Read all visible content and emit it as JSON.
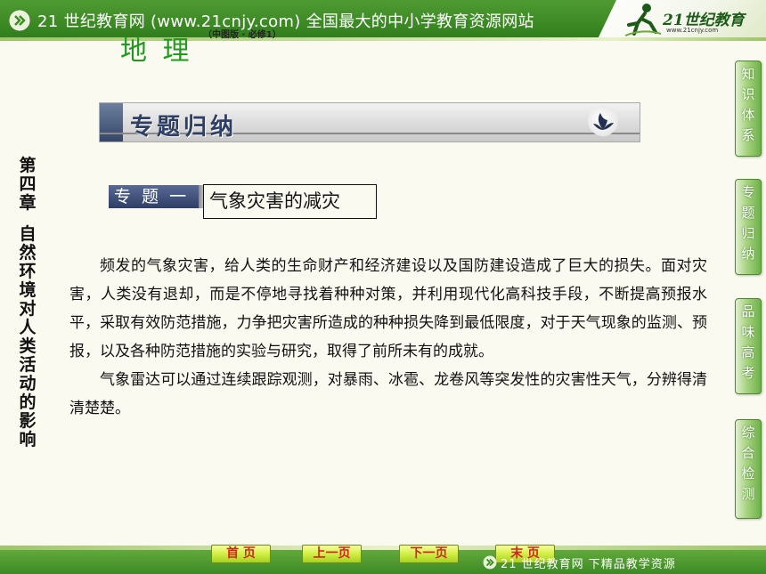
{
  "banner": {
    "text": "21 世纪教育网 (www.21cnjy.com)  全国最大的中小学教育资源网站",
    "logo_text": "21世纪教育",
    "logo_url": "www.21cnjy.com"
  },
  "subject": {
    "title": "地 理",
    "edition": "（中图版 · 必修1）"
  },
  "section": {
    "title": "专题归纳"
  },
  "chapter": {
    "number": "第四章",
    "name": "自然环境对人类活动的影响"
  },
  "topic": {
    "badge": "专 题 一",
    "title": "气象灾害的减灾"
  },
  "body": {
    "paragraphs": [
      "频发的气象灾害，给人类的生命财产和经济建设以及国防建设造成了巨大的损失。面对灾害，人类没有退却，而是不停地寻找着种种对策，并利用现代化高科技手段，不断提高预报水平，采取有效防范措施，力争把灾害所造成的种种损失降到最低限度，对于天气现象的监测、预报，以及各种防范措施的实验与研究，取得了前所未有的成就。",
      "气象雷达可以通过连续跟踪观测，对暴雨、冰雹、龙卷风等突发性的灾害性天气，分辨得清清楚楚。"
    ]
  },
  "side_nav": [
    {
      "label": "知识体系"
    },
    {
      "label": "专题归纳"
    },
    {
      "label": "品味高考"
    },
    {
      "label": "综合检测"
    }
  ],
  "bottom_nav": {
    "first": "首 页",
    "prev": "上一页",
    "next": "下一页",
    "last": "末 页",
    "footer": "21 世纪教育网   下精品教学资源"
  },
  "colors": {
    "banner_green": "#3d8a25",
    "subject_green": "#1f9a1f",
    "section_navy": "#2e3f66",
    "nav_button_red": "#d2261c"
  },
  "icons": {
    "banner_arrows": "double-chevron-right-icon",
    "logo": "running-figure-icon",
    "section_leaf": "leaf-icon",
    "footer_arrows": "double-chevron-right-icon"
  }
}
